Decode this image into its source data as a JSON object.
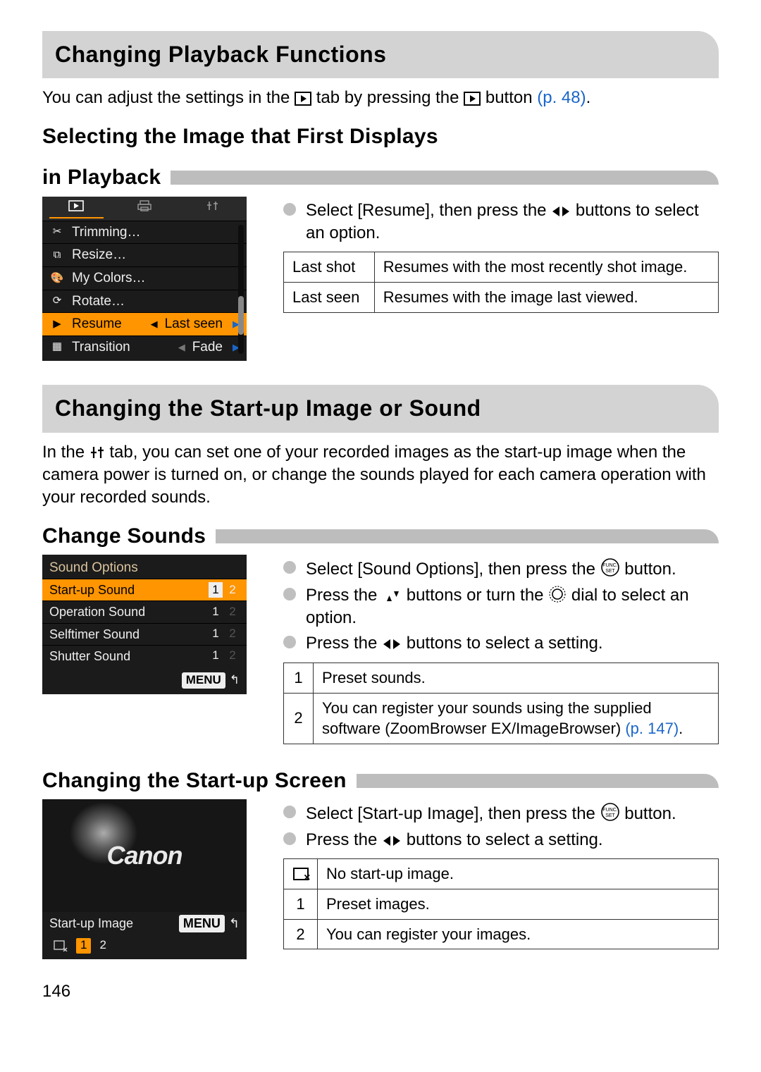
{
  "page_number": "146",
  "section1": {
    "title": "Changing Playback Functions",
    "body_before_tab": "You can adjust the settings in the ",
    "body_mid": " tab by pressing the ",
    "body_after_button": " button ",
    "body_ref": "(p. 48)",
    "body_end": "."
  },
  "subA": {
    "title_line1": "Selecting the Image that First Displays",
    "title_line2": "in Playback",
    "bullet": "Select [Resume], then press the ",
    "bullet_after": " buttons to select an option.",
    "table": [
      {
        "k": "Last shot",
        "v": "Resumes with the most recently shot image."
      },
      {
        "k": "Last seen",
        "v": "Resumes with the image last viewed."
      }
    ],
    "cam_menu": {
      "items": [
        {
          "icon": "crop-icon",
          "label": "Trimming…"
        },
        {
          "icon": "resize-icon",
          "label": "Resize…"
        },
        {
          "icon": "palette-icon",
          "label": "My Colors…"
        },
        {
          "icon": "rotate-icon",
          "label": "Rotate…"
        },
        {
          "icon": "play-icon",
          "label": "Resume",
          "value": "Last seen",
          "hi": true
        },
        {
          "icon": "trans-icon",
          "label": "Transition",
          "value": "Fade"
        }
      ]
    }
  },
  "section2": {
    "title": "Changing the Start-up Image or Sound",
    "body_before": "In the ",
    "body_after": " tab, you can set one of your recorded images as the start-up image when the camera power is turned on, or change the sounds played for each camera operation with your recorded sounds."
  },
  "subB": {
    "title": "Change Sounds",
    "bullets": [
      {
        "pre": "Select [Sound Options], then press the ",
        "post": " button.",
        "icon": "funcset"
      },
      {
        "pre": "Press the ",
        "mid": " buttons or turn the ",
        "post": " dial to select an option.",
        "icon1": "updown",
        "icon2": "circle"
      },
      {
        "pre": "Press the ",
        "post": " buttons to select a setting.",
        "icon": "leftright"
      }
    ],
    "table": [
      {
        "k": "1",
        "v": "Preset sounds."
      },
      {
        "k": "2",
        "v": "You can register your sounds using the supplied software (ZoomBrowser EX/ImageBrowser) ",
        "ref": "(p. 147)",
        "end": "."
      }
    ],
    "cam": {
      "title": "Sound Options",
      "rows": [
        {
          "label": "Start-up Sound",
          "sel": 1,
          "hi": true
        },
        {
          "label": "Operation Sound",
          "sel": 1
        },
        {
          "label": "Selftimer Sound",
          "sel": 1
        },
        {
          "label": "Shutter Sound",
          "sel": 1
        }
      ],
      "menu_label": "MENU"
    }
  },
  "subC": {
    "title": "Changing the Start-up Screen",
    "bullets": [
      {
        "pre": "Select [Start-up Image], then press the ",
        "post": " button.",
        "icon": "funcset"
      },
      {
        "pre": "Press the ",
        "post": " buttons to select a setting.",
        "icon": "leftright"
      }
    ],
    "table": [
      {
        "k_icon": "xbox",
        "v": "No start-up image."
      },
      {
        "k": "1",
        "v": "Preset images."
      },
      {
        "k": "2",
        "v": "You can register your images."
      }
    ],
    "cam": {
      "brand": "Canon",
      "label": "Start-up Image",
      "menu_label": "MENU",
      "options": [
        {
          "label_icon": "xbox"
        },
        {
          "label": "1",
          "sel": true
        },
        {
          "label": "2"
        }
      ]
    }
  }
}
